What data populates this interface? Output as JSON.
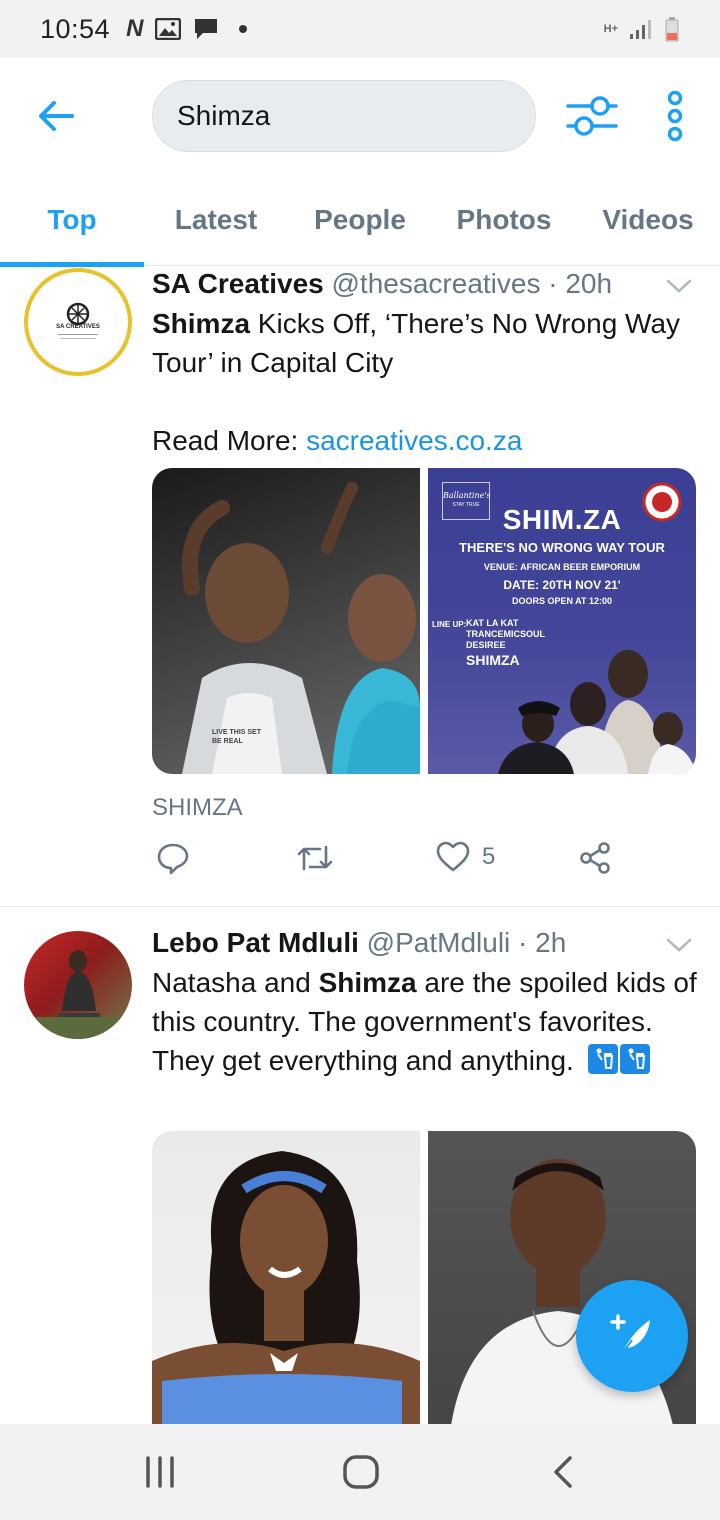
{
  "status_bar": {
    "time": "10:54",
    "network_label": "H+"
  },
  "search": {
    "query": "Shimza"
  },
  "tabs": [
    {
      "label": "Top",
      "active": true
    },
    {
      "label": "Latest",
      "active": false
    },
    {
      "label": "People",
      "active": false
    },
    {
      "label": "Photos",
      "active": false
    },
    {
      "label": "Videos",
      "active": false
    }
  ],
  "tweets": [
    {
      "name": "SA Creatives",
      "handle": "@thesacreatives",
      "separator": "·",
      "time": "20h",
      "avatar_text": "SA CREATIVES",
      "text_bold": "Shimza",
      "text_rest": " Kicks Off, ‘There’s No Wrong Way Tour’ in Capital City",
      "read_more_label": "Read More:",
      "link": "sacreatives.co.za",
      "caption": "SHIMZA",
      "likes": "5",
      "poster": {
        "brand": "Ballantine's",
        "brand_sub": "STAY TRUE",
        "title": "SHIM.ZA",
        "subtitle": "THERE'S NO WRONG WAY TOUR",
        "venue": "VENUE: AFRICAN BEER EMPORIUM",
        "date": "DATE: 20TH NOV 21'",
        "doors": "DOORS OPEN AT 12:00",
        "lineup_label": "LINE UP:",
        "lineup": [
          "KAT LA KAT",
          "TRANCEMICSOUL",
          "DESIREE",
          "SHIMZA"
        ]
      },
      "photo_shirt_text": "LIVE THIS SET BE REAL"
    },
    {
      "name": "Lebo Pat Mdluli",
      "handle": "@PatMdluli",
      "separator": "·",
      "time": "2h",
      "text_pre": "Natasha and ",
      "text_bold": "Shimza",
      "text_rest": " are the spoiled kids of this country. The government's favorites. They get everything and anything."
    }
  ],
  "colors": {
    "accent": "#1da1f2",
    "link": "#1b95e0",
    "muted": "#657786",
    "search_bg": "#e6ecf0"
  },
  "icons": {
    "back": "arrow-left-icon",
    "filter": "sliders-icon",
    "more": "vertical-dots-icon",
    "reply": "speech-bubble-icon",
    "retweet": "retweet-icon",
    "like": "heart-icon",
    "share": "share-icon",
    "compose": "feather-plus-icon",
    "trash": "trash-icon"
  }
}
